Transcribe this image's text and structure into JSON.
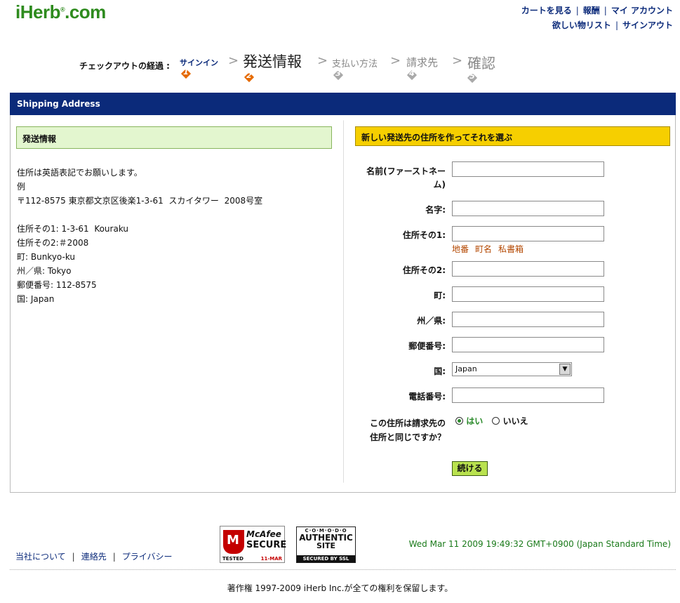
{
  "header": {
    "logo": "iHerb",
    "logo_reg": "®",
    "logo_suffix": ".com",
    "links_row1": [
      "カートを見る",
      "報酬",
      "マイ アカウント"
    ],
    "links_row2": [
      "欲しい物リスト",
      "サインアウト"
    ],
    "separator": "|"
  },
  "progress": {
    "label": "チェックアウトの経過 :",
    "chevron": ">",
    "steps": [
      {
        "name": "サインイン",
        "num": "1",
        "state": "done"
      },
      {
        "name": "発送情報",
        "num": "2",
        "state": "current"
      },
      {
        "name": "支払い方法",
        "num": "3",
        "state": "pending"
      },
      {
        "name": "請求先",
        "num": "4",
        "state": "pending"
      },
      {
        "name": "確認",
        "num": "5",
        "state": "pending"
      }
    ]
  },
  "panel": {
    "title": "Shipping Address"
  },
  "left": {
    "box_title": "発送情報",
    "lines": [
      "住所は英語表記でお願いします。",
      "例",
      "〒112-8575 東京都文京区後楽1-3-61  スカイタワー  2008号室",
      "",
      "住所その1: 1-3-61  Kouraku",
      "住所その2:＃2008",
      "町: Bunkyo-ku",
      "州／県: Tokyo",
      "郵便番号: 112-8575",
      "国: Japan"
    ]
  },
  "form": {
    "box_title": "新しい発送先の住所を作ってそれを選ぶ",
    "first_name_label_1": "名前(ファーストネー",
    "first_name_label_2": "ム)",
    "last_name_label": "名字:",
    "address1_label": "住所その1:",
    "address1_hints": [
      "地番",
      "町名",
      "私書箱"
    ],
    "address2_label": "住所その2:",
    "city_label": "町:",
    "state_label": "州／県:",
    "zip_label": "郵便番号:",
    "country_label": "国:",
    "country_value": "Japan",
    "phone_label": "電話番号:",
    "same_label_1": "この住所は請求先の",
    "same_label_2": "住所と同じですか？",
    "yes_label": "はい",
    "no_label": "いいえ",
    "submit_label": "続ける"
  },
  "footer": {
    "links": [
      "当社について",
      "連絡先",
      "プライバシー"
    ],
    "separator": "|",
    "mcafee": {
      "brand": "McAfee",
      "secure": "SECURE",
      "tested": "TESTED",
      "date": "11-MAR"
    },
    "comodo": {
      "brand": "C·O·M·O·D·O",
      "authentic": "AUTHENTIC",
      "site": "SITE",
      "ssl": "SECURED BY SSL"
    },
    "timestamp": "Wed Mar 11 2009 19:49:32 GMT+0900 (Japan Standard Time)",
    "copyright": "著作権  1997-2009 iHerb Inc.が全ての権利を保留します。"
  },
  "colors": {
    "nav_blue": "#0b2a7a",
    "brand_green": "#2e8b1e",
    "step_active": "#e56a00",
    "step_inactive": "#a9a9a9",
    "hint_orange": "#b34700"
  }
}
